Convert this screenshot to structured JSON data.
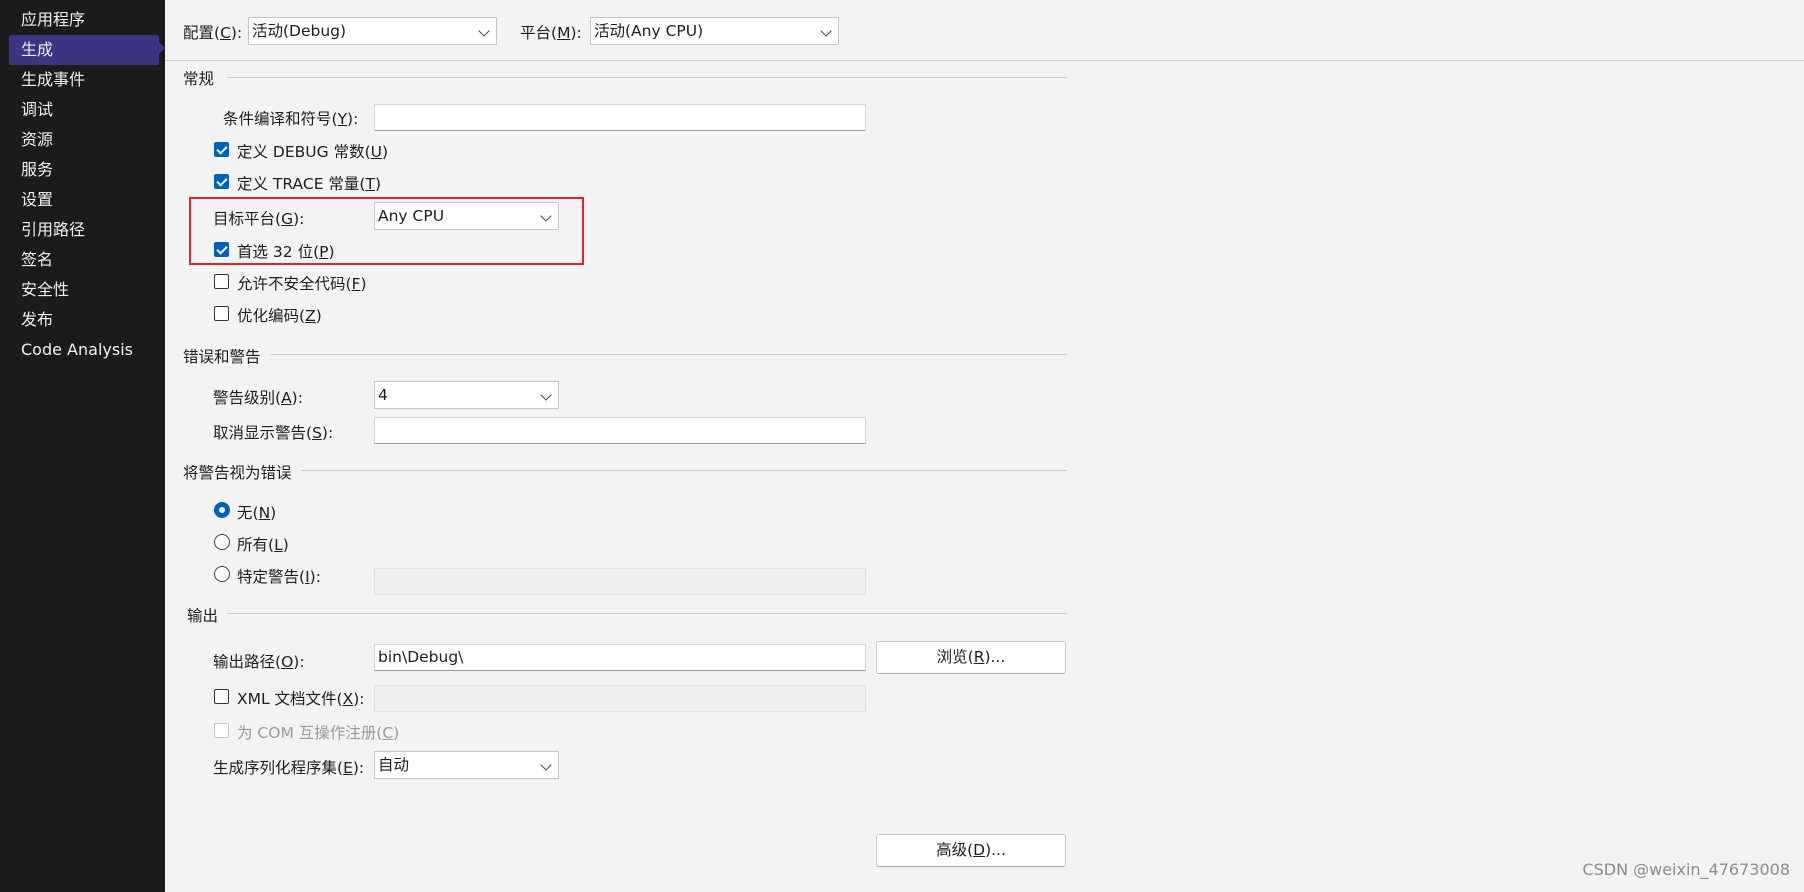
{
  "sidebar": {
    "items": [
      {
        "label": "应用程序"
      },
      {
        "label": "生成"
      },
      {
        "label": "生成事件"
      },
      {
        "label": "调试"
      },
      {
        "label": "资源"
      },
      {
        "label": "服务"
      },
      {
        "label": "设置"
      },
      {
        "label": "引用路径"
      },
      {
        "label": "签名"
      },
      {
        "label": "安全性"
      },
      {
        "label": "发布"
      },
      {
        "label": "Code Analysis"
      }
    ],
    "active_index": 1
  },
  "header": {
    "config_label_pre": "配置(",
    "config_key": "C",
    "config_label_post": "):",
    "config_value": "活动(Debug)",
    "platform_label_pre": "平台(",
    "platform_key": "M",
    "platform_label_post": "):",
    "platform_value": "活动(Any CPU)"
  },
  "general": {
    "title": "常规",
    "conditional_symbols": {
      "pre": "条件编译和符号(",
      "key": "Y",
      "post": "):",
      "value": ""
    },
    "define_debug": {
      "pre": "定义 DEBUG 常数(",
      "key": "U",
      "post": ")",
      "checked": true
    },
    "define_trace": {
      "pre": "定义 TRACE 常量(",
      "key": "T",
      "post": ")",
      "checked": true
    },
    "target_platform": {
      "pre": "目标平台(",
      "key": "G",
      "post": "):",
      "value": "Any CPU"
    },
    "prefer32": {
      "pre": "首选 32 位(",
      "key": "P",
      "post": ")",
      "checked": true
    },
    "allow_unsafe": {
      "pre": "允许不安全代码(",
      "key": "F",
      "post": ")",
      "checked": false
    },
    "optimize": {
      "pre": "优化编码(",
      "key": "Z",
      "post": ")",
      "checked": false
    }
  },
  "errors": {
    "title": "错误和警告",
    "warning_level": {
      "pre": "警告级别(",
      "key": "A",
      "post": "):",
      "value": "4"
    },
    "suppress": {
      "pre": "取消显示警告(",
      "key": "S",
      "post": "):",
      "value": ""
    }
  },
  "treat_warnings": {
    "title": "将警告视为错误",
    "none": {
      "pre": "无(",
      "key": "N",
      "post": ")",
      "selected": true
    },
    "all": {
      "pre": "所有(",
      "key": "L",
      "post": ")",
      "selected": false
    },
    "specific": {
      "pre": "特定警告(",
      "key": "I",
      "post": "):",
      "selected": false,
      "value": ""
    }
  },
  "output": {
    "title": "输出",
    "path": {
      "pre": "输出路径(",
      "key": "O",
      "post": "):",
      "value": "bin\\Debug\\"
    },
    "browse": {
      "pre": "浏览(",
      "key": "R",
      "post": ")..."
    },
    "xml_doc": {
      "pre": "XML 文档文件(",
      "key": "X",
      "post": "):",
      "checked": false,
      "value": ""
    },
    "com_register": {
      "pre": "为 COM 互操作注册(",
      "key": "C",
      "post": ")",
      "checked": false
    },
    "serialization": {
      "pre": "生成序列化程序集(",
      "key": "E",
      "post": "):",
      "value": "自动"
    }
  },
  "advanced": {
    "pre": "高级(",
    "key": "D",
    "post": ")..."
  },
  "watermark": "CSDN @weixin_47673008",
  "colors": {
    "accent": "#005fb8",
    "sidebar_bg": "#1b1b1b",
    "active_item": "#3b3583",
    "highlight_border": "#d9282f"
  }
}
